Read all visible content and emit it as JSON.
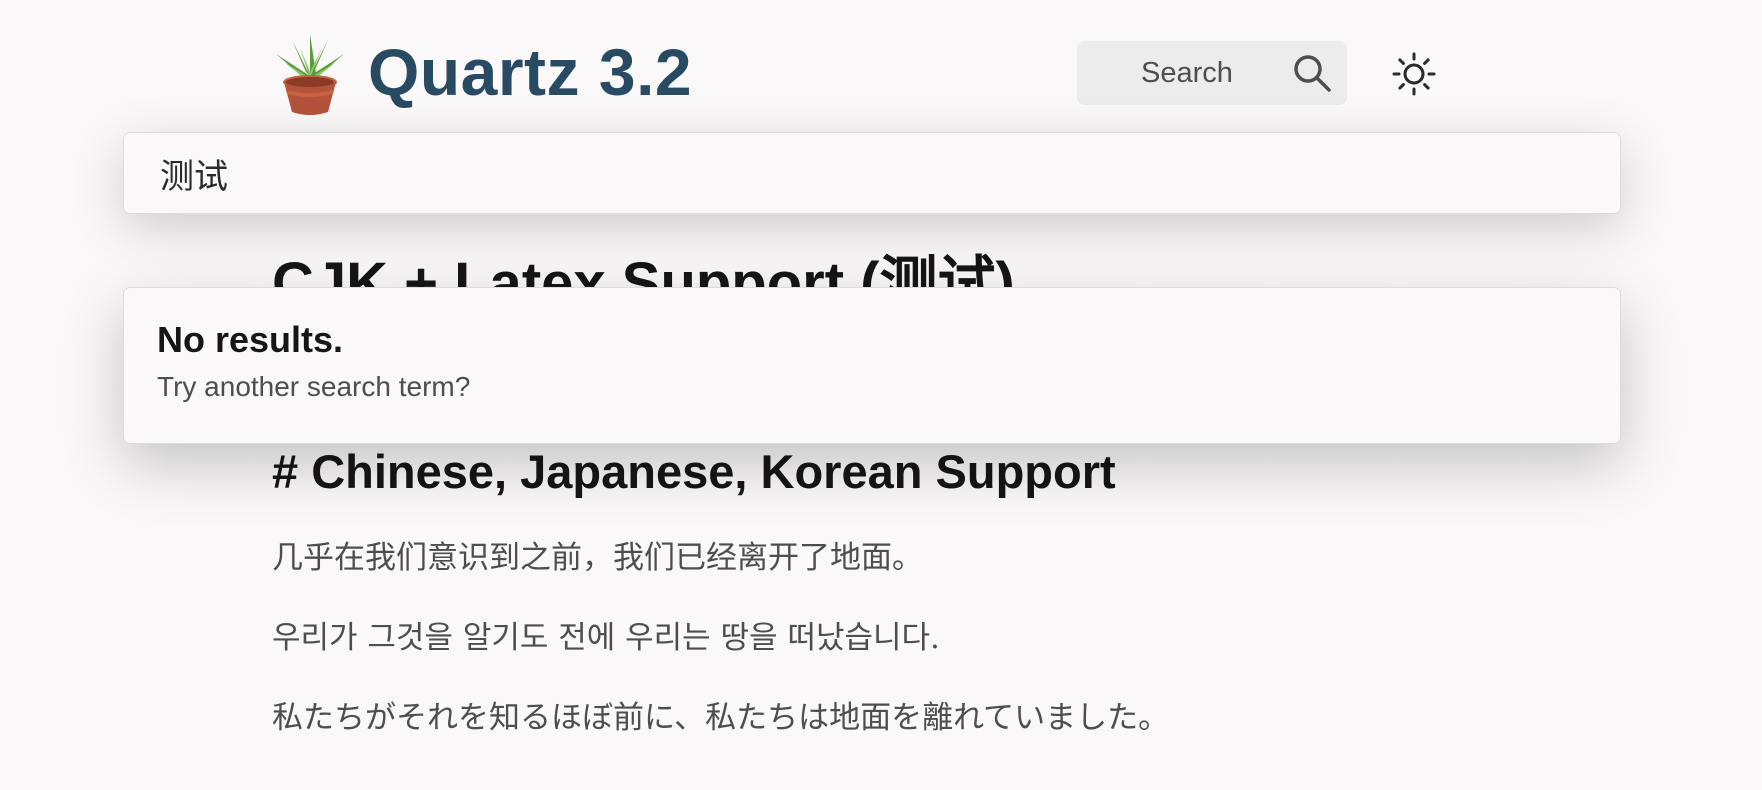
{
  "header": {
    "site_title": "Quartz 3.2",
    "logo_icon": "potted-plant-icon",
    "search_button_label": "Search",
    "search_icon": "magnifier-icon",
    "theme_toggle_icon": "sun-icon"
  },
  "search": {
    "query": "测试",
    "no_results_title": "No results.",
    "no_results_hint": "Try another search term?"
  },
  "article": {
    "title": "CJK + Latex Support (测试)",
    "section_hash": "#",
    "section_heading": "Chinese, Japanese, Korean Support",
    "paragraphs": [
      "几乎在我们意识到之前，我们已经离开了地面。",
      "우리가 그것을 알기도 전에 우리는 땅을 떠났습니다.",
      "私たちがそれを知るほぼ前に、私たちは地面を離れていました。"
    ]
  },
  "colors": {
    "background": "#faf8f8",
    "title_blue": "#284b63",
    "heading_dark": "#161618",
    "body_gray": "#4e4e4e",
    "search_button_bg": "#ececec"
  }
}
